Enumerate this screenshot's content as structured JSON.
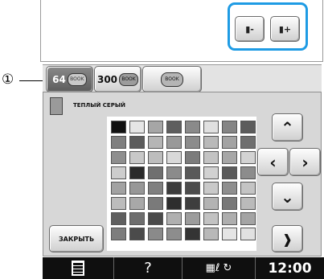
{
  "callout": {
    "marker": "①"
  },
  "thread_buttons": {
    "minus_label": "▮-",
    "plus_label": "▮+"
  },
  "tabs": [
    {
      "label": "64",
      "sub": "BOOK"
    },
    {
      "label": "300",
      "sub": "BOOK"
    },
    {
      "label": "",
      "sub": "BOOK"
    }
  ],
  "selected_color": {
    "name": "ТЕПЛЫЙ СЕРЫЙ"
  },
  "palette": [
    [
      "#111111",
      "#e6e6e6",
      "#a6a6a6",
      "#5e5e5e",
      "#8a8a8a",
      "#e0e0e0",
      "#858585",
      "#5c5c5c"
    ],
    [
      "#7f7f7f",
      "#5c5c5c",
      "#b5b5b5",
      "#999999",
      "#8c8c8c",
      "#b9b9b9",
      "#a3a3a3",
      "#6f6f6f"
    ],
    [
      "#8e8e8e",
      "#c8c8c8",
      "#bdbdbd",
      "#d9d9d9",
      "#7c7c7c",
      "#c3c3c3",
      "#a7a7a7",
      "#d3d3d3"
    ],
    [
      "#cdcdcd",
      "#2a2a2a",
      "#6f6f6f",
      "#8b8b8b",
      "#595959",
      "#d1d1d1",
      "#5b5b5b",
      "#8c8c8c"
    ],
    [
      "#a2a2a2",
      "#979797",
      "#808080",
      "#3c3c3c",
      "#4c4c4c",
      "#c9c9c9",
      "#8e8e8e",
      "#c4c4c4"
    ],
    [
      "#bcbcbc",
      "#a8a8a8",
      "#7a7a7a",
      "#2e2e2e",
      "#3e3e3e",
      "#b3b3b3",
      "#787878",
      "#bababa"
    ],
    [
      "#5f5f5f",
      "#6e6e6e",
      "#4a4a4a",
      "#b0b0b0",
      "#9c9c9c",
      "#c2c2c2",
      "#aeaeae",
      "#a4a4a4"
    ],
    [
      "#7d7d7d",
      "#4b4b4b",
      "#8a8a8a",
      "#8d8d8d",
      "#343434",
      "#b8b8b8",
      "#e5e5e5",
      "#e1e1e1"
    ]
  ],
  "buttons": {
    "close_label": "ЗАКРЫТЬ"
  },
  "statusbar": {
    "help": "?",
    "time": "12:00"
  }
}
